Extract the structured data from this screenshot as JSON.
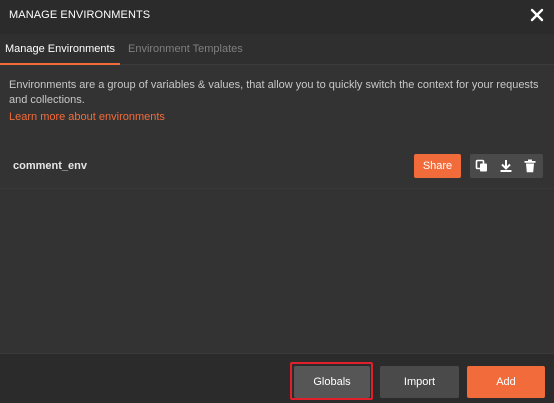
{
  "header": {
    "title": "MANAGE ENVIRONMENTS",
    "close_icon": "close-icon"
  },
  "tabs": [
    {
      "label": "Manage Environments",
      "active": true
    },
    {
      "label": "Environment Templates",
      "active": false
    }
  ],
  "main": {
    "description": "Environments are a group of variables & values, that allow you to quickly switch the context for your requests and collections.",
    "learn_link": "Learn more about environments",
    "environments": [
      {
        "name": "comment_env",
        "share_label": "Share",
        "actions": [
          "duplicate-icon",
          "download-icon",
          "trash-icon"
        ]
      }
    ]
  },
  "footer": {
    "globals_label": "Globals",
    "import_label": "Import",
    "add_label": "Add"
  },
  "colors": {
    "accent": "#f26b3a",
    "highlight_outline": "#e0202a",
    "background": "#303030"
  }
}
